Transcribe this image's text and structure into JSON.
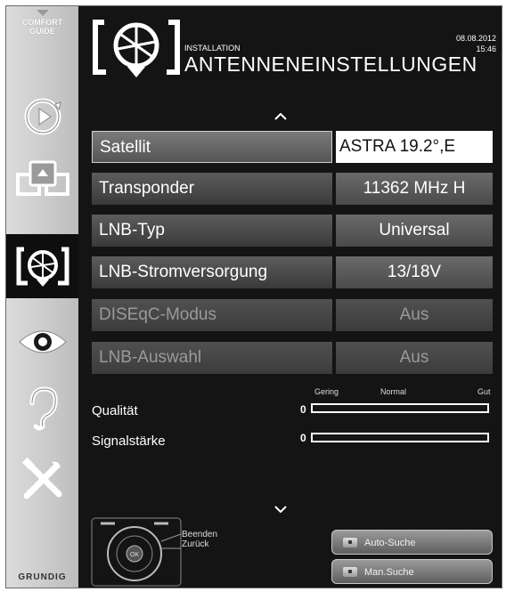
{
  "sidebar": {
    "comfort_line1": "COMFORT",
    "comfort_line2": "GUIDE",
    "brand": "GRUNDIG",
    "items": [
      {
        "icon": "playback-icon"
      },
      {
        "icon": "media-icon"
      },
      {
        "icon": "satellite-dish-icon",
        "active": true
      },
      {
        "icon": "eye-icon"
      },
      {
        "icon": "ear-icon"
      },
      {
        "icon": "tools-icon"
      }
    ]
  },
  "header": {
    "icon": "satellite-dish-icon",
    "section": "INSTALLATION",
    "title": "ANTENNENEINSTELLUNGEN",
    "date": "08.08.2012",
    "time": "15:46"
  },
  "menu": {
    "rows": [
      {
        "label": "Satellit",
        "value": "ASTRA 19.2°,E",
        "selected": true,
        "disabled": false
      },
      {
        "label": "Transponder",
        "value": "11362 MHz H",
        "selected": false,
        "disabled": false
      },
      {
        "label": "LNB-Typ",
        "value": "Universal",
        "selected": false,
        "disabled": false
      },
      {
        "label": "LNB-Stromversorgung",
        "value": "13/18V",
        "selected": false,
        "disabled": false
      },
      {
        "label": "DISEqC-Modus",
        "value": "Aus",
        "selected": false,
        "disabled": true
      },
      {
        "label": "LNB-Auswahl",
        "value": "Aus",
        "selected": false,
        "disabled": true
      }
    ]
  },
  "signal": {
    "scale_labels": [
      "Gering",
      "Normal",
      "Gut"
    ],
    "quality": {
      "label": "Qualität",
      "value_text": "0",
      "level": 0
    },
    "strength": {
      "label": "Signalstärke",
      "value_text": "0",
      "level": 0
    }
  },
  "footer": {
    "legend_exit": "Beenden",
    "legend_back": "Zurück",
    "auto_search": "Auto-Suche",
    "manual_search": "Man.Suche"
  },
  "colors": {
    "background": "#141414",
    "sidebar": "#cfcfcf",
    "row": "#4a4a4a",
    "selected_value": "#ffffff",
    "text": "#ffffff",
    "disabled_text": "#9a9a9a"
  }
}
